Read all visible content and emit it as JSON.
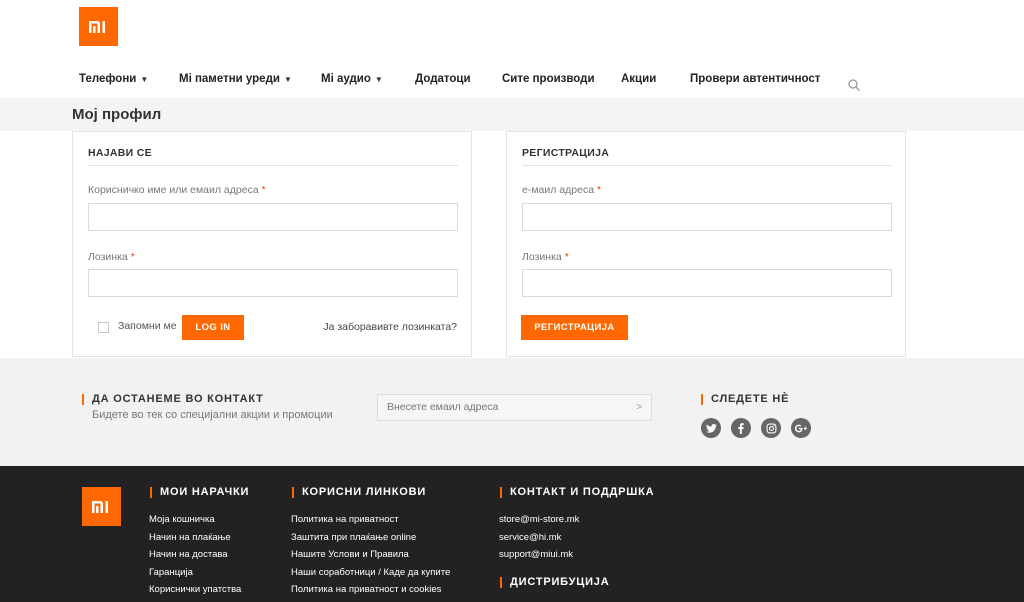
{
  "nav": {
    "items": [
      {
        "label": "Телефони",
        "dropdown": true
      },
      {
        "label": "Mi паметни уреди",
        "dropdown": true
      },
      {
        "label": "Mi аудио",
        "dropdown": true
      },
      {
        "label": "Додатоци",
        "dropdown": false
      },
      {
        "label": "Сите производи",
        "dropdown": false
      },
      {
        "label": "Акции",
        "dropdown": false
      },
      {
        "label": "Провери автентичност",
        "dropdown": false
      }
    ],
    "chevron": "⌄"
  },
  "page": {
    "title": "Мој профил"
  },
  "login": {
    "title": "НАЈАВИ СЕ",
    "username_label": "Корисничко име или емаил адреса",
    "password_label": "Лозинка",
    "required": "*",
    "remember_label": "Запомни ме",
    "submit_label": "LOG IN",
    "forgot_label": "Ја заборавивте лозинката?"
  },
  "register": {
    "title": "РЕГИСТРАЦИЈА",
    "email_label": "е-маил адреса",
    "password_label": "Лозинка",
    "required": "*",
    "submit_label": "РЕГИСТРАЦИЈА"
  },
  "newsletter": {
    "title": "ДА ОСТАНЕМЕ ВО КОНТАКТ",
    "subtitle": "Бидете во тек со специјални акции и промоции",
    "email_placeholder": "Внесете емаил адреса",
    "arrow": ">",
    "follow_title": "СЛЕДЕТЕ НÈ",
    "social_icons": [
      "twitter-icon",
      "facebook-icon",
      "instagram-icon",
      "google-plus-icon"
    ]
  },
  "footer": {
    "orders_title": "МОИ НАРАЧКИ",
    "orders_links": [
      "Моја кошничка",
      "Начин на плаќање",
      "Начин на достава",
      "Гаранција",
      "Кориснички упатства"
    ],
    "links_title": "КОРИСНИ ЛИНКОВИ",
    "useful_links": [
      "Политика на приватност",
      "Заштита при плаќање online",
      "Нашите Услови и Правила",
      "Наши соработници / Каде да купите",
      "Политика на приватност и cookies"
    ],
    "contact_title": "КОНТАКТ И ПОДДРШКА",
    "contact_links": [
      "store@mi-store.mk",
      "service@hi.mk",
      "support@miui.mk"
    ],
    "distribution_title": "ДИСТРИБУЦИЈА"
  },
  "colors": {
    "accent": "#ff6700",
    "footer_bg": "#222222",
    "newsletter_bg": "#f2f2f2"
  }
}
